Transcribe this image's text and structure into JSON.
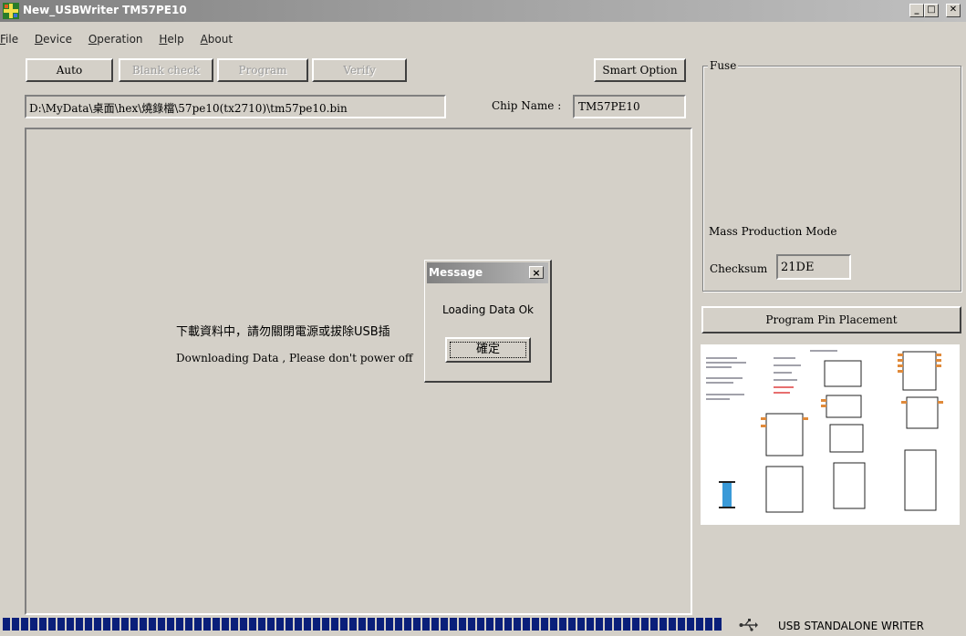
{
  "window": {
    "title": "New_USBWriter  TM57PE10",
    "controls": [
      "_",
      "□",
      "✕"
    ]
  },
  "menu": [
    {
      "label": "File",
      "accel": "F",
      "rest": "ile"
    },
    {
      "label": "Device",
      "accel": "D",
      "rest": "evice"
    },
    {
      "label": "Operation",
      "accel": "O",
      "rest": "peration"
    },
    {
      "label": "Help",
      "accel": "H",
      "rest": "elp"
    },
    {
      "label": "About",
      "accel": "A",
      "rest": "bout"
    }
  ],
  "toolbar": {
    "auto": "Auto",
    "blank_check": "Blank check",
    "program": "Program",
    "verify": "Verify",
    "smart_option": "Smart Option"
  },
  "file_path": "D:\\MyData\\桌面\\hex\\燒錄檔\\57pe10(tx2710)\\tm57pe10.bin",
  "chip": {
    "label": "Chip Name :",
    "value": "TM57PE10"
  },
  "main_panel": {
    "line1": "下載資料中，請勿關閉電源或拔除USB插",
    "line2": "Downloading Data , Please don't power off"
  },
  "fuse_group": {
    "label": "Fuse",
    "mass_production": "Mass Production Mode",
    "checksum_label": "Checksum",
    "checksum_value": "21DE"
  },
  "pin_button": "Program Pin Placement",
  "dialog": {
    "title": "Message",
    "message": "Loading Data Ok",
    "ok": "確定"
  },
  "status": {
    "progress": 1.0,
    "device_label": "USB STANDALONE WRITER"
  },
  "colors": {
    "face": "#d4d0c8",
    "progress": "#0a1f7a"
  }
}
